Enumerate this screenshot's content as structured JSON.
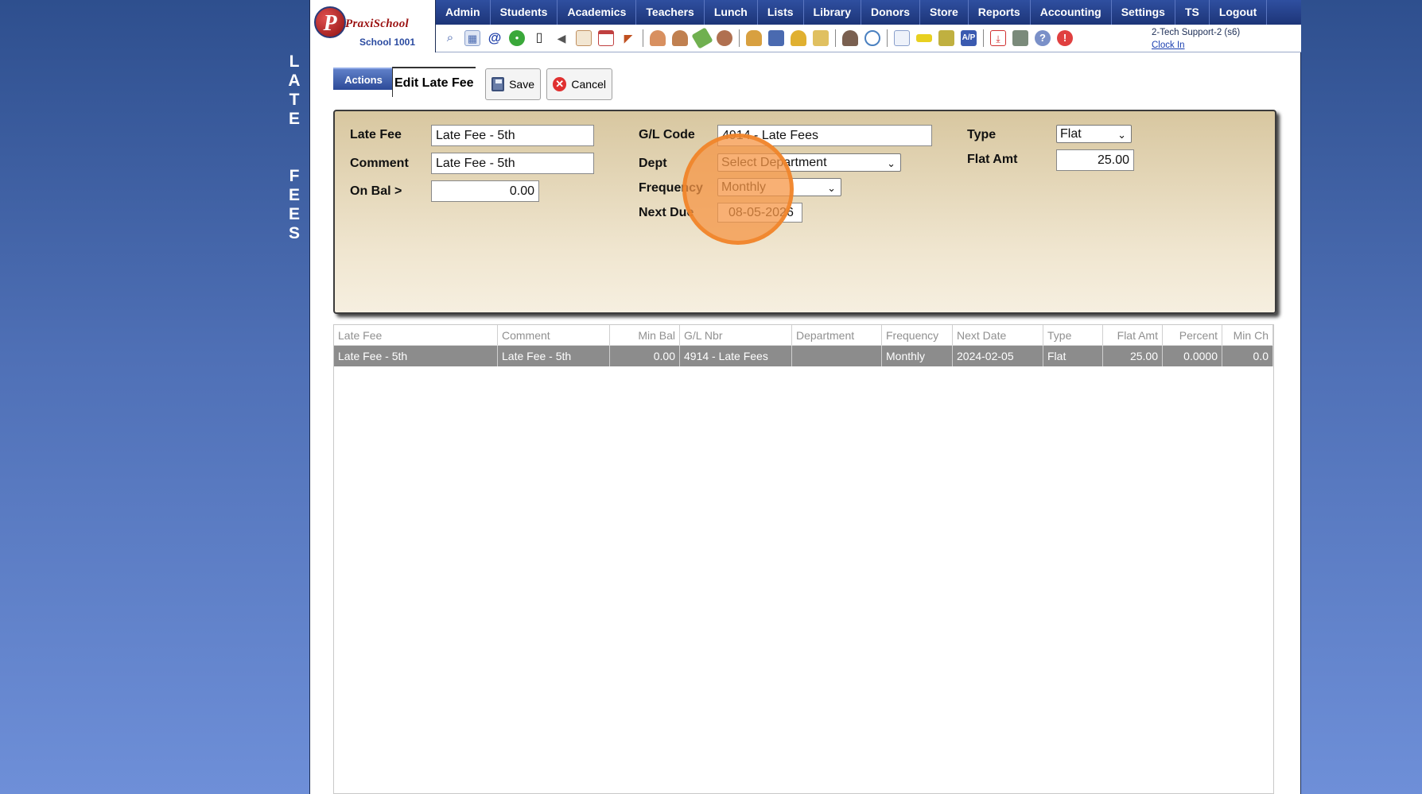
{
  "side_title": [
    "L",
    "A",
    "T",
    "E",
    "",
    "F",
    "E",
    "E",
    "S"
  ],
  "logo": {
    "brand": "PraxiSchool",
    "school": "School 1001"
  },
  "menu": [
    "Admin",
    "Students",
    "Academics",
    "Teachers",
    "Lunch",
    "Lists",
    "Library",
    "Donors",
    "Store",
    "Reports",
    "Accounting",
    "Settings",
    "TS",
    "Logout"
  ],
  "toolbar_icons": [
    "search-icon",
    "grid-icon",
    "at-icon",
    "chat-icon",
    "phone-icon",
    "speaker-icon",
    "calendar-grid-icon",
    "calendar-icon",
    "megaphone-icon",
    "person-add-icon",
    "person-icon",
    "money-icon",
    "people-icon",
    "lunch-icon",
    "book-icon",
    "bell-icon",
    "envelope-icon",
    "teacher-icon",
    "clock-icon",
    "report-icon",
    "card-icon",
    "printer-icon",
    "ap-icon",
    "pdf-icon",
    "register-icon",
    "help-icon",
    "power-icon"
  ],
  "user": {
    "name": "2-Tech Support-2 (s6)",
    "clock_in": "Clock In"
  },
  "actions": {
    "tab": "Actions",
    "title": "Edit Late Fee",
    "save": "Save",
    "cancel": "Cancel"
  },
  "form": {
    "late_fee_label": "Late Fee",
    "late_fee_value": "Late Fee - 5th",
    "comment_label": "Comment",
    "comment_value": "Late Fee - 5th",
    "on_bal_label": "On Bal >",
    "on_bal_value": "0.00",
    "gl_label": "G/L Code",
    "gl_value": "4914 - Late Fees",
    "dept_label": "Dept",
    "dept_value": "Select Department",
    "freq_label": "Frequency",
    "freq_value": "Monthly",
    "next_due_label": "Next Due",
    "next_due_value": "08-05-2026",
    "type_label": "Type",
    "type_value": "Flat",
    "flat_amt_label": "Flat Amt",
    "flat_amt_value": "25.00"
  },
  "grid": {
    "headers": [
      "Late Fee",
      "Comment",
      "Min Bal",
      "G/L Nbr",
      "Department",
      "Frequency",
      "Next Date",
      "Type",
      "Flat Amt",
      "Percent",
      "Min Ch"
    ],
    "rows": [
      [
        "Late Fee - 5th",
        "Late Fee - 5th",
        "0.00",
        "4914 - Late Fees",
        "",
        "Monthly",
        "2024-02-05",
        "Flat",
        "25.00",
        "0.0000",
        "0.0"
      ]
    ]
  }
}
